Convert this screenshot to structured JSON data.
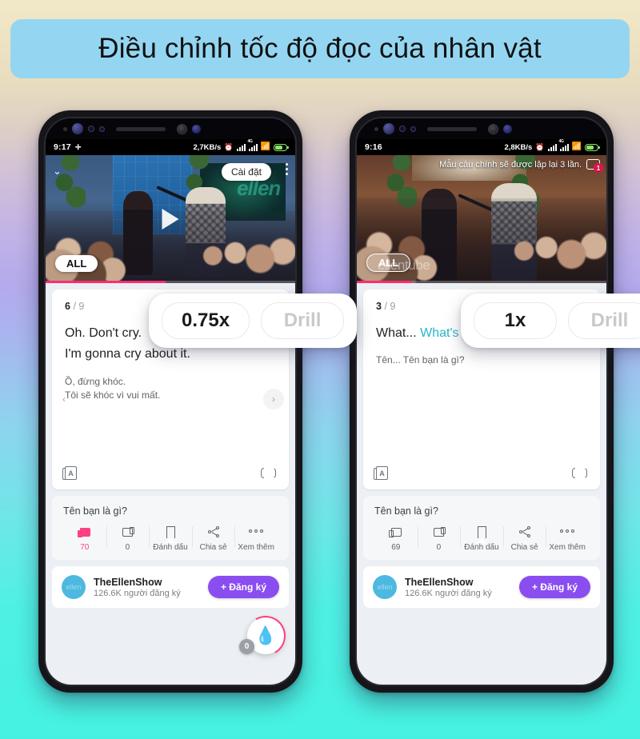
{
  "banner": {
    "title": "Điều chỉnh tốc độ đọc của nhân vật",
    "bg_color": "#94d6f2"
  },
  "accent": {
    "subscribe": "#8a4df0",
    "like_pink": "#ff4081",
    "progress": "#ff2d6f",
    "highlight": "#27b6cc"
  },
  "phones": [
    {
      "id": "left",
      "status": {
        "time": "9:17",
        "network_speed": "2,7KB/s",
        "bluetooth_icon": "bluetooth-icon",
        "alarm_icon": "alarm-icon",
        "wifi_icon": "wifi-icon",
        "battery_icon": "battery-charging-icon"
      },
      "video": {
        "settings_label": "Cài đặt",
        "all_badge": "ALL",
        "play_icon": "play-icon",
        "kebab_icon": "more-vertical-icon",
        "collapse_icon": "chevron-down-icon",
        "toast": null,
        "watermark": null
      },
      "subtitle": {
        "index": "6",
        "separator": "/",
        "total": "9",
        "english_lines": [
          {
            "text": "Oh. Don't cry.",
            "highlight": false
          },
          {
            "text": "I'm gonna cry about it.",
            "highlight": false
          }
        ],
        "vietnamese_lines": [
          "Ồ, đừng khóc.",
          "Tôi sẽ khóc vì vui mất."
        ],
        "prev_icon": "chevron-left-icon",
        "next_icon": "chevron-right-icon",
        "dict_icon": "dictionary-icon",
        "loop_icon": "repeat-icon"
      },
      "meta": {
        "title": "Tên bạn là gì?",
        "actions": [
          {
            "name": "like",
            "icon": "thumb-up-icon",
            "label": "70",
            "active": true
          },
          {
            "name": "dislike",
            "icon": "thumb-down-icon",
            "label": "0",
            "active": false
          },
          {
            "name": "bookmark",
            "icon": "bookmark-icon",
            "label": "Đánh dấu",
            "active": false
          },
          {
            "name": "share",
            "icon": "share-icon",
            "label": "Chia sẻ",
            "active": false
          },
          {
            "name": "more",
            "icon": "more-horizontal-icon",
            "label": "Xem thêm",
            "active": false
          }
        ]
      },
      "channel": {
        "avatar_text": "ellen",
        "name": "TheEllenShow",
        "subscribers": "126.6K người đăng ký",
        "subscribe_label": "+ Đăng ký"
      },
      "fab": {
        "icon": "flame-icon",
        "badge": "0"
      },
      "speed_card": {
        "speed_label": "0.75x",
        "drill_label": "Drill"
      }
    },
    {
      "id": "right",
      "status": {
        "time": "9:16",
        "network_speed": "2,8KB/s",
        "bluetooth_icon": "bluetooth-icon",
        "alarm_icon": "alarm-icon",
        "wifi_icon": "wifi-icon",
        "battery_icon": "battery-charging-icon"
      },
      "video": {
        "settings_label": null,
        "all_badge": "ALL",
        "play_icon": null,
        "kebab_icon": null,
        "collapse_icon": null,
        "toast": {
          "text": "Mẫu câu chính sẽ được lặp lại 3 lần.",
          "badge_count": "1",
          "icon": "repeat-badge-icon"
        },
        "watermark": "ellentube"
      },
      "subtitle": {
        "index": "3",
        "separator": "/",
        "total": "9",
        "english_lines": [
          {
            "text": "What... ",
            "highlight": false
          },
          {
            "text": "What's your name?",
            "highlight": true
          }
        ],
        "vietnamese_lines": [
          "Tên... Tên bạn là gì?"
        ],
        "prev_icon": null,
        "next_icon": null,
        "dict_icon": "dictionary-icon",
        "loop_icon": "repeat-icon"
      },
      "meta": {
        "title": "Tên bạn là gì?",
        "actions": [
          {
            "name": "like",
            "icon": "thumb-up-icon",
            "label": "69",
            "active": false
          },
          {
            "name": "dislike",
            "icon": "thumb-down-icon",
            "label": "0",
            "active": false
          },
          {
            "name": "bookmark",
            "icon": "bookmark-icon",
            "label": "Đánh dấu",
            "active": false
          },
          {
            "name": "share",
            "icon": "share-icon",
            "label": "Chia sẻ",
            "active": false
          },
          {
            "name": "more",
            "icon": "more-horizontal-icon",
            "label": "Xem thêm",
            "active": false
          }
        ]
      },
      "channel": {
        "avatar_text": "ellen",
        "name": "TheEllenShow",
        "subscribers": "126.6K người đăng ký",
        "subscribe_label": "+ Đăng ký"
      },
      "fab": null,
      "speed_card": {
        "speed_label": "1x",
        "drill_label": "Drill"
      }
    }
  ]
}
